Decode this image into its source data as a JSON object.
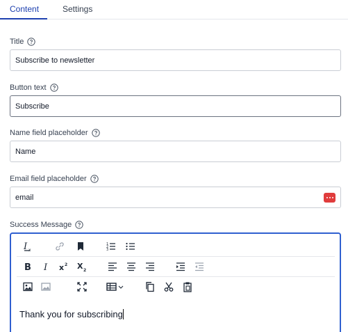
{
  "tabs": [
    {
      "label": "Content",
      "active": true
    },
    {
      "label": "Settings",
      "active": false
    }
  ],
  "fields": {
    "title": {
      "label": "Title",
      "value": "Subscribe to newsletter"
    },
    "button_text": {
      "label": "Button text",
      "value": "Subscribe"
    },
    "name_placeholder": {
      "label": "Name field placeholder",
      "value": "Name"
    },
    "email_placeholder": {
      "label": "Email field placeholder",
      "value": "email"
    },
    "success_message": {
      "label": "Success Message"
    }
  },
  "editor": {
    "content": "Thank you for subscribing",
    "toolbar_rows": [
      [
        "clear-formatting-icon",
        "link-icon",
        "bookmark-icon",
        "numbered-list-icon",
        "bulleted-list-icon"
      ],
      [
        "bold-icon",
        "italic-icon",
        "superscript-icon",
        "subscript-icon",
        "align-left-icon",
        "align-center-icon",
        "align-right-icon",
        "indent-icon",
        "outdent-icon"
      ],
      [
        "image-icon",
        "media-icon",
        "fullscreen-icon",
        "table-icon",
        "copy-icon",
        "cut-icon",
        "paste-icon"
      ]
    ]
  },
  "colors": {
    "accent": "#1e40af",
    "focus_border": "#2f5fd0",
    "password_icon": "#e03c3c"
  }
}
